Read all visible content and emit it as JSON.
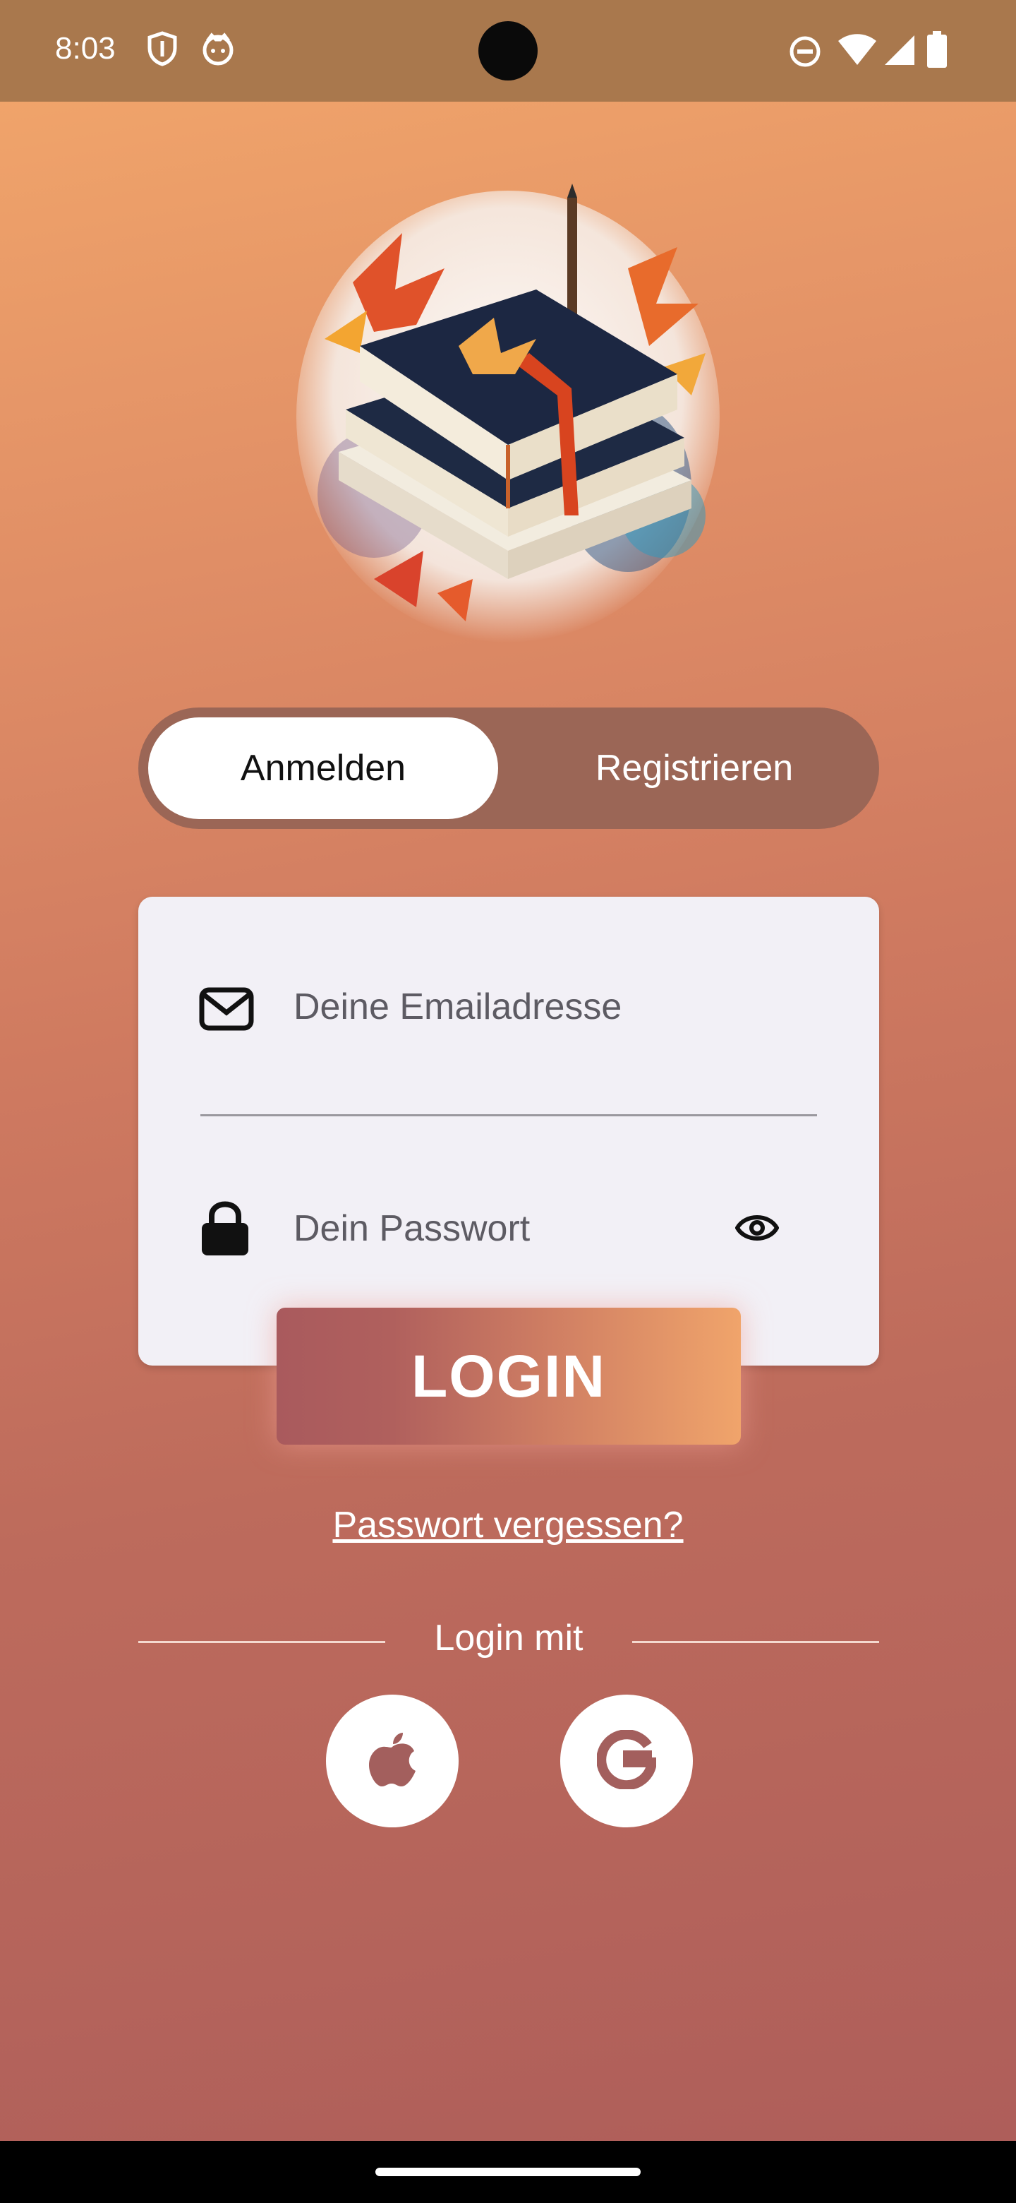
{
  "status_bar": {
    "time": "8:03",
    "left_icons": [
      "shield-icon",
      "face-icon"
    ],
    "right_icons": [
      "do-not-disturb-icon",
      "wifi-icon",
      "signal-icon",
      "battery-icon"
    ]
  },
  "hero": {
    "image": "autumn-books-illustration"
  },
  "tabs": [
    {
      "label": "Anmelden",
      "active": true
    },
    {
      "label": "Registrieren",
      "active": false
    }
  ],
  "form": {
    "email": {
      "placeholder": "Deine Emailadresse",
      "icon": "mail-icon"
    },
    "password": {
      "placeholder": "Dein Passwort",
      "icon": "lock-icon",
      "toggle_icon": "eye-icon"
    }
  },
  "login_button": "LOGIN",
  "forgot_password": "Passwort vergessen?",
  "login_with": "Login mit",
  "social": [
    {
      "name": "apple",
      "icon": "apple-icon"
    },
    {
      "name": "google",
      "icon": "google-icon"
    }
  ],
  "colors": {
    "status_bar": "#a9784d",
    "accent": "#a95a5d",
    "card": "#f2f0f6",
    "segment": "#9b6656"
  }
}
